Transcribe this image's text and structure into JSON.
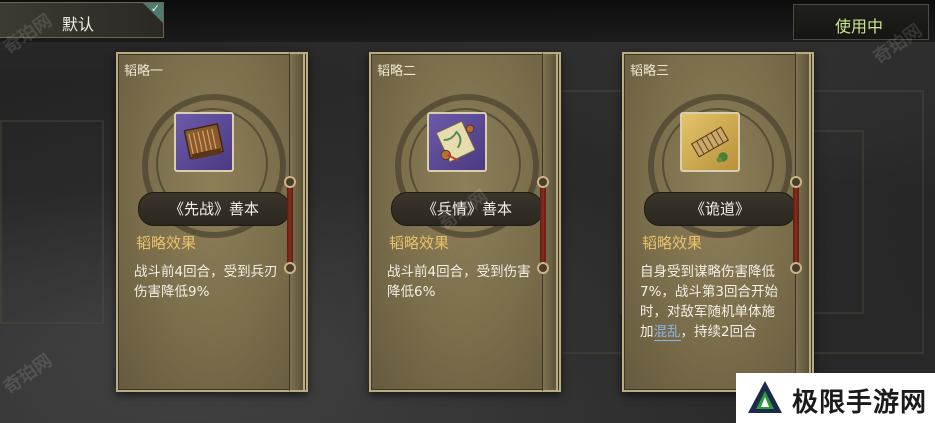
{
  "top_bar": {
    "default_tab_label": "默认",
    "in_use_label": "使用中"
  },
  "cards": [
    {
      "tag": "韬略一",
      "name": "《先战》善本",
      "icon": "bamboo-book-icon",
      "effect_title": "韬略效果",
      "effect_text": "战斗前4回合，受到兵刃伤害降低9%"
    },
    {
      "tag": "韬略二",
      "name": "《兵情》善本",
      "icon": "scroll-icon",
      "effect_title": "韬略效果",
      "effect_text": "战斗前4回合，受到伤害降低6%"
    },
    {
      "tag": "韬略三",
      "name": "《诡道》",
      "icon": "bamboo-slips-icon",
      "effect_title": "韬略效果",
      "effect_text_pre": "自身受到谋略伤害降低7%，战斗第3回合开始时，对敌军随机单体施加",
      "effect_highlight": "混乱",
      "effect_text_post": "，持续2回合"
    }
  ],
  "watermark": "奇珀网",
  "brand": {
    "name": "极限手游网"
  },
  "colors": {
    "in_use_text": "#c9e78a",
    "effect_title": "#e8c36a",
    "highlight_link": "#8ab6e8"
  }
}
